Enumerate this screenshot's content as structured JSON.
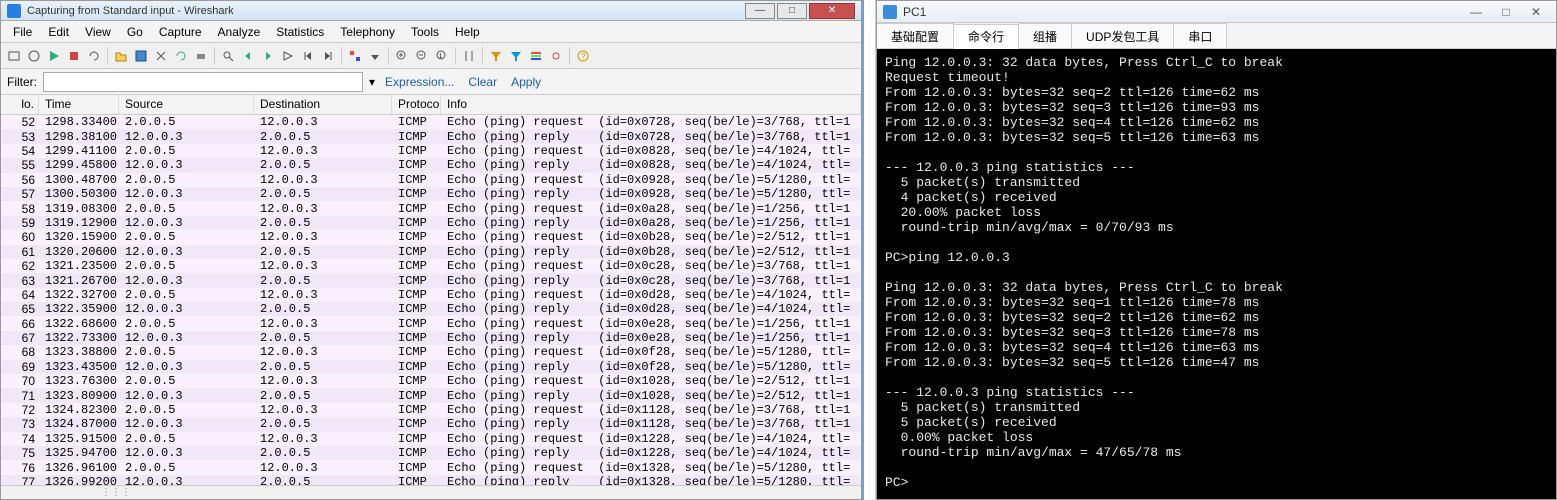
{
  "wireshark": {
    "title": "Capturing from Standard input - Wireshark",
    "menu": [
      "File",
      "Edit",
      "View",
      "Go",
      "Capture",
      "Analyze",
      "Statistics",
      "Telephony",
      "Tools",
      "Help"
    ],
    "filter_label": "Filter:",
    "filter_value": "",
    "expression": "Expression...",
    "clear": "Clear",
    "apply": "Apply",
    "columns": {
      "no": "lo.",
      "time": "Time",
      "src": "Source",
      "dst": "Destination",
      "proto": "Protocol",
      "info": "Info"
    },
    "rows": [
      {
        "no": "52",
        "time": "1298.33400",
        "src": "2.0.0.5",
        "dst": "12.0.0.3",
        "proto": "ICMP",
        "info": "Echo (ping) request  (id=0x0728, seq(be/le)=3/768, ttl=1"
      },
      {
        "no": "53",
        "time": "1298.38100",
        "src": "12.0.0.3",
        "dst": "2.0.0.5",
        "proto": "ICMP",
        "info": "Echo (ping) reply    (id=0x0728, seq(be/le)=3/768, ttl=1"
      },
      {
        "no": "54",
        "time": "1299.41100",
        "src": "2.0.0.5",
        "dst": "12.0.0.3",
        "proto": "ICMP",
        "info": "Echo (ping) request  (id=0x0828, seq(be/le)=4/1024, ttl="
      },
      {
        "no": "55",
        "time": "1299.45800",
        "src": "12.0.0.3",
        "dst": "2.0.0.5",
        "proto": "ICMP",
        "info": "Echo (ping) reply    (id=0x0828, seq(be/le)=4/1024, ttl="
      },
      {
        "no": "56",
        "time": "1300.48700",
        "src": "2.0.0.5",
        "dst": "12.0.0.3",
        "proto": "ICMP",
        "info": "Echo (ping) request  (id=0x0928, seq(be/le)=5/1280, ttl="
      },
      {
        "no": "57",
        "time": "1300.50300",
        "src": "12.0.0.3",
        "dst": "2.0.0.5",
        "proto": "ICMP",
        "info": "Echo (ping) reply    (id=0x0928, seq(be/le)=5/1280, ttl="
      },
      {
        "no": "58",
        "time": "1319.08300",
        "src": "2.0.0.5",
        "dst": "12.0.0.3",
        "proto": "ICMP",
        "info": "Echo (ping) request  (id=0x0a28, seq(be/le)=1/256, ttl=1"
      },
      {
        "no": "59",
        "time": "1319.12900",
        "src": "12.0.0.3",
        "dst": "2.0.0.5",
        "proto": "ICMP",
        "info": "Echo (ping) reply    (id=0x0a28, seq(be/le)=1/256, ttl=1"
      },
      {
        "no": "60",
        "time": "1320.15900",
        "src": "2.0.0.5",
        "dst": "12.0.0.3",
        "proto": "ICMP",
        "info": "Echo (ping) request  (id=0x0b28, seq(be/le)=2/512, ttl=1"
      },
      {
        "no": "61",
        "time": "1320.20600",
        "src": "12.0.0.3",
        "dst": "2.0.0.5",
        "proto": "ICMP",
        "info": "Echo (ping) reply    (id=0x0b28, seq(be/le)=2/512, ttl=1"
      },
      {
        "no": "62",
        "time": "1321.23500",
        "src": "2.0.0.5",
        "dst": "12.0.0.3",
        "proto": "ICMP",
        "info": "Echo (ping) request  (id=0x0c28, seq(be/le)=3/768, ttl=1"
      },
      {
        "no": "63",
        "time": "1321.26700",
        "src": "12.0.0.3",
        "dst": "2.0.0.5",
        "proto": "ICMP",
        "info": "Echo (ping) reply    (id=0x0c28, seq(be/le)=3/768, ttl=1"
      },
      {
        "no": "64",
        "time": "1322.32700",
        "src": "2.0.0.5",
        "dst": "12.0.0.3",
        "proto": "ICMP",
        "info": "Echo (ping) request  (id=0x0d28, seq(be/le)=4/1024, ttl="
      },
      {
        "no": "65",
        "time": "1322.35900",
        "src": "12.0.0.3",
        "dst": "2.0.0.5",
        "proto": "ICMP",
        "info": "Echo (ping) reply    (id=0x0d28, seq(be/le)=4/1024, ttl="
      },
      {
        "no": "66",
        "time": "1322.68600",
        "src": "2.0.0.5",
        "dst": "12.0.0.3",
        "proto": "ICMP",
        "info": "Echo (ping) request  (id=0x0e28, seq(be/le)=1/256, ttl=1"
      },
      {
        "no": "67",
        "time": "1322.73300",
        "src": "12.0.0.3",
        "dst": "2.0.0.5",
        "proto": "ICMP",
        "info": "Echo (ping) reply    (id=0x0e28, seq(be/le)=1/256, ttl=1"
      },
      {
        "no": "68",
        "time": "1323.38800",
        "src": "2.0.0.5",
        "dst": "12.0.0.3",
        "proto": "ICMP",
        "info": "Echo (ping) request  (id=0x0f28, seq(be/le)=5/1280, ttl="
      },
      {
        "no": "69",
        "time": "1323.43500",
        "src": "12.0.0.3",
        "dst": "2.0.0.5",
        "proto": "ICMP",
        "info": "Echo (ping) reply    (id=0x0f28, seq(be/le)=5/1280, ttl="
      },
      {
        "no": "70",
        "time": "1323.76300",
        "src": "2.0.0.5",
        "dst": "12.0.0.3",
        "proto": "ICMP",
        "info": "Echo (ping) request  (id=0x1028, seq(be/le)=2/512, ttl=1"
      },
      {
        "no": "71",
        "time": "1323.80900",
        "src": "12.0.0.3",
        "dst": "2.0.0.5",
        "proto": "ICMP",
        "info": "Echo (ping) reply    (id=0x1028, seq(be/le)=2/512, ttl=1"
      },
      {
        "no": "72",
        "time": "1324.82300",
        "src": "2.0.0.5",
        "dst": "12.0.0.3",
        "proto": "ICMP",
        "info": "Echo (ping) request  (id=0x1128, seq(be/le)=3/768, ttl=1"
      },
      {
        "no": "73",
        "time": "1324.87000",
        "src": "12.0.0.3",
        "dst": "2.0.0.5",
        "proto": "ICMP",
        "info": "Echo (ping) reply    (id=0x1128, seq(be/le)=3/768, ttl=1"
      },
      {
        "no": "74",
        "time": "1325.91500",
        "src": "2.0.0.5",
        "dst": "12.0.0.3",
        "proto": "ICMP",
        "info": "Echo (ping) request  (id=0x1228, seq(be/le)=4/1024, ttl="
      },
      {
        "no": "75",
        "time": "1325.94700",
        "src": "12.0.0.3",
        "dst": "2.0.0.5",
        "proto": "ICMP",
        "info": "Echo (ping) reply    (id=0x1228, seq(be/le)=4/1024, ttl="
      },
      {
        "no": "76",
        "time": "1326.96100",
        "src": "2.0.0.5",
        "dst": "12.0.0.3",
        "proto": "ICMP",
        "info": "Echo (ping) request  (id=0x1328, seq(be/le)=5/1280, ttl="
      },
      {
        "no": "77",
        "time": "1326.99200",
        "src": "12.0.0.3",
        "dst": "2.0.0.5",
        "proto": "ICMP",
        "info": "Echo (ping) reply    (id=0x1328, seq(be/le)=5/1280, ttl="
      }
    ]
  },
  "pc1": {
    "title": "PC1",
    "tabs": [
      "基础配置",
      "命令行",
      "组播",
      "UDP发包工具",
      "串口"
    ],
    "active_tab": 1,
    "terminal": "Ping 12.0.0.3: 32 data bytes, Press Ctrl_C to break\nRequest timeout!\nFrom 12.0.0.3: bytes=32 seq=2 ttl=126 time=62 ms\nFrom 12.0.0.3: bytes=32 seq=3 ttl=126 time=93 ms\nFrom 12.0.0.3: bytes=32 seq=4 ttl=126 time=62 ms\nFrom 12.0.0.3: bytes=32 seq=5 ttl=126 time=63 ms\n\n--- 12.0.0.3 ping statistics ---\n  5 packet(s) transmitted\n  4 packet(s) received\n  20.00% packet loss\n  round-trip min/avg/max = 0/70/93 ms\n\nPC>ping 12.0.0.3\n\nPing 12.0.0.3: 32 data bytes, Press Ctrl_C to break\nFrom 12.0.0.3: bytes=32 seq=1 ttl=126 time=78 ms\nFrom 12.0.0.3: bytes=32 seq=2 ttl=126 time=62 ms\nFrom 12.0.0.3: bytes=32 seq=3 ttl=126 time=78 ms\nFrom 12.0.0.3: bytes=32 seq=4 ttl=126 time=63 ms\nFrom 12.0.0.3: bytes=32 seq=5 ttl=126 time=47 ms\n\n--- 12.0.0.3 ping statistics ---\n  5 packet(s) transmitted\n  5 packet(s) received\n  0.00% packet loss\n  round-trip min/avg/max = 47/65/78 ms\n\nPC>"
  }
}
